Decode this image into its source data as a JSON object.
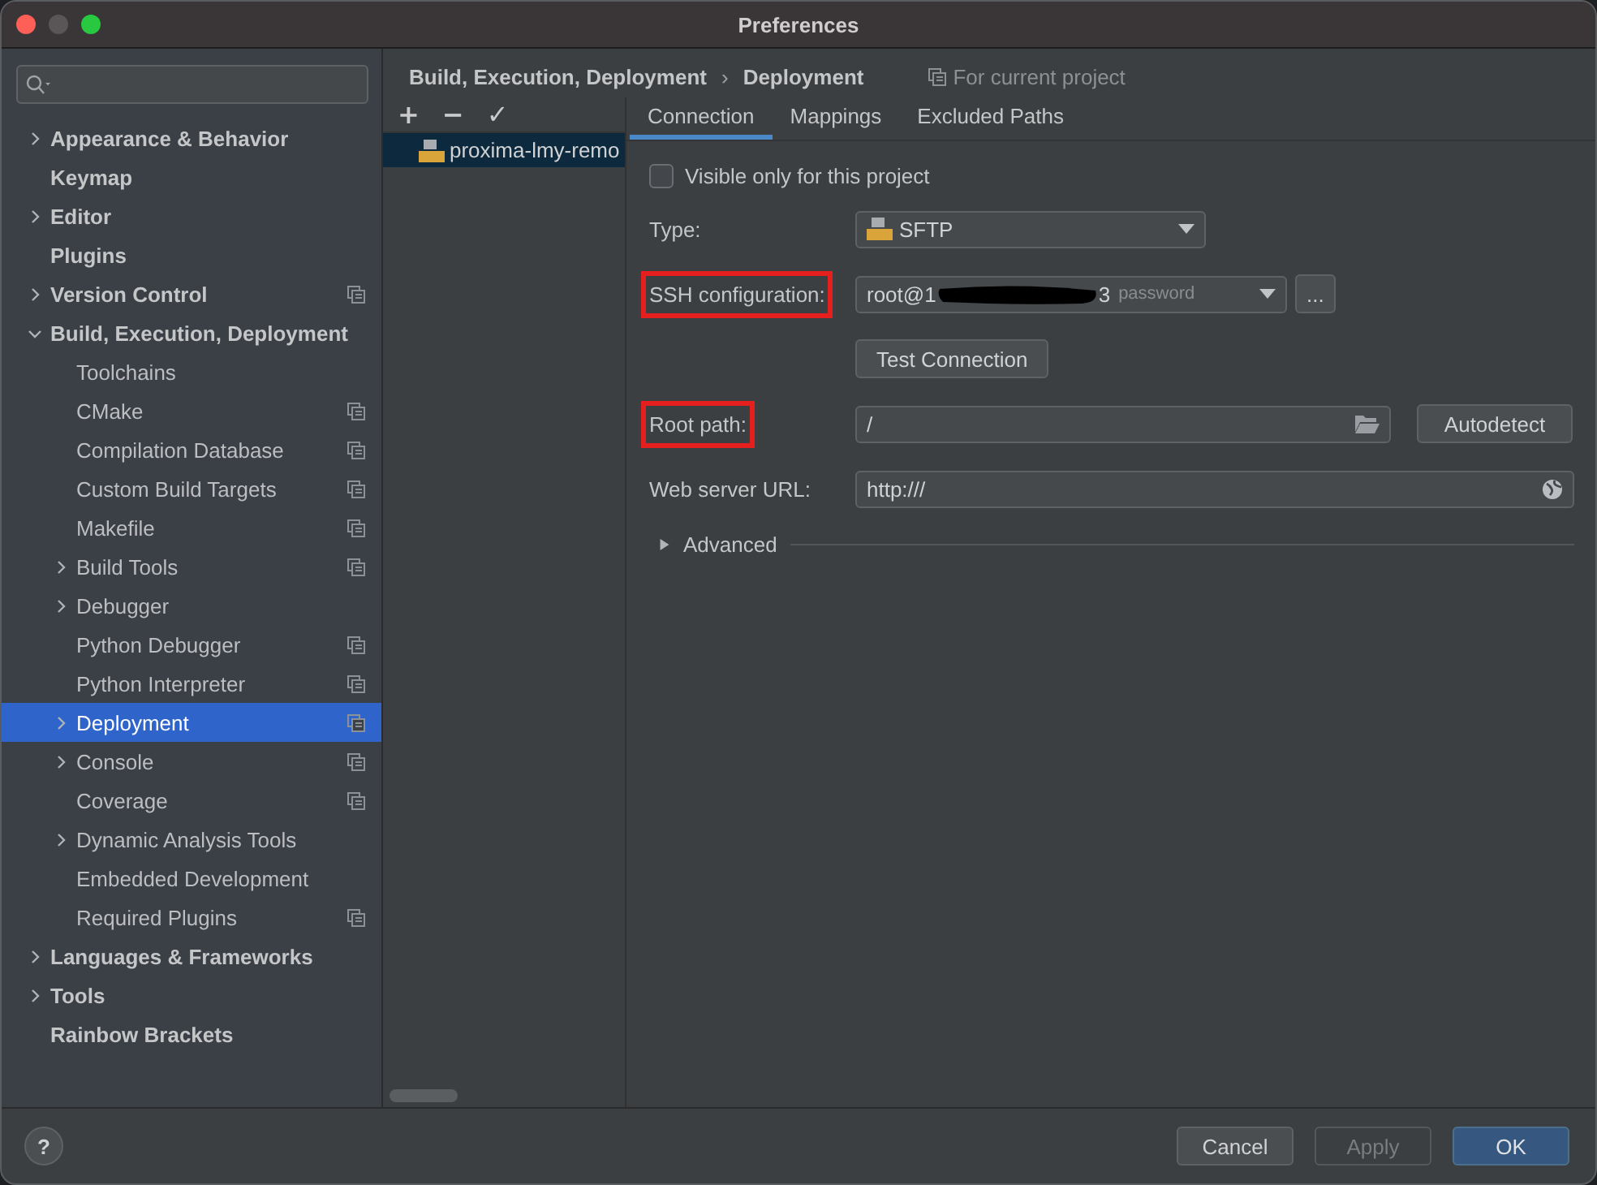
{
  "window": {
    "title": "Preferences"
  },
  "sidebar": {
    "items": [
      {
        "label": "Appearance & Behavior",
        "expanded": false,
        "selected": false
      },
      {
        "label": "Keymap",
        "selected": false
      },
      {
        "label": "Editor",
        "expanded": false,
        "selected": false
      },
      {
        "label": "Plugins",
        "selected": false
      },
      {
        "label": "Version Control",
        "expanded": false,
        "project_level": true,
        "selected": false
      },
      {
        "label": "Build, Execution, Deployment",
        "expanded": true,
        "selected": false,
        "children": [
          {
            "label": "Toolchains",
            "selected": false
          },
          {
            "label": "CMake",
            "project_level": true,
            "selected": false
          },
          {
            "label": "Compilation Database",
            "project_level": true,
            "selected": false
          },
          {
            "label": "Custom Build Targets",
            "project_level": true,
            "selected": false
          },
          {
            "label": "Makefile",
            "project_level": true,
            "selected": false
          },
          {
            "label": "Build Tools",
            "expanded": false,
            "project_level": true,
            "selected": false
          },
          {
            "label": "Debugger",
            "expanded": false,
            "selected": false
          },
          {
            "label": "Python Debugger",
            "project_level": true,
            "selected": false
          },
          {
            "label": "Python Interpreter",
            "project_level": true,
            "selected": false
          },
          {
            "label": "Deployment",
            "expanded": false,
            "project_level": true,
            "selected": true
          },
          {
            "label": "Console",
            "expanded": false,
            "project_level": true,
            "selected": false
          },
          {
            "label": "Coverage",
            "project_level": true,
            "selected": false
          },
          {
            "label": "Dynamic Analysis Tools",
            "expanded": false,
            "selected": false
          },
          {
            "label": "Embedded Development",
            "selected": false
          },
          {
            "label": "Required Plugins",
            "project_level": true,
            "selected": false
          }
        ]
      },
      {
        "label": "Languages & Frameworks",
        "expanded": false,
        "selected": false
      },
      {
        "label": "Tools",
        "expanded": false,
        "selected": false
      },
      {
        "label": "Rainbow Brackets",
        "selected": false
      }
    ]
  },
  "breadcrumb": {
    "items": [
      "Build, Execution, Deployment",
      "Deployment"
    ],
    "separator": "›",
    "scope": "For current project"
  },
  "toolbar": {
    "buttons": [
      "+",
      "−",
      "✓"
    ]
  },
  "servers": [
    {
      "name": "proxima-lmy-remo",
      "selected": true
    }
  ],
  "tabs": [
    {
      "label": "Connection",
      "selected": true
    },
    {
      "label": "Mappings",
      "selected": false
    },
    {
      "label": "Excluded Paths",
      "selected": false
    }
  ],
  "visible_only": {
    "label": "Visible only for this project",
    "checked": false
  },
  "form": {
    "type": {
      "label": "Type:",
      "value": "SFTP"
    },
    "ssh": {
      "label": "SSH configuration:",
      "highlighted": true,
      "value_start": "root@1",
      "redacted": true,
      "value_end": "3",
      "hint": "password",
      "more_button": "..."
    },
    "test_button": "Test Connection",
    "root_path": {
      "label": "Root path:",
      "highlighted": true,
      "value": "/",
      "button": "Autodetect"
    },
    "web_url": {
      "label": "Web server URL:",
      "highlighted": false,
      "value": "http:///"
    },
    "advanced": {
      "label": "Advanced",
      "expanded": false
    }
  },
  "footer": {
    "help": "?",
    "buttons": [
      {
        "label": "Cancel",
        "kind": "normal",
        "disabled": false
      },
      {
        "label": "Apply",
        "kind": "normal",
        "disabled": true
      },
      {
        "label": "OK",
        "kind": "default",
        "disabled": false
      }
    ]
  }
}
